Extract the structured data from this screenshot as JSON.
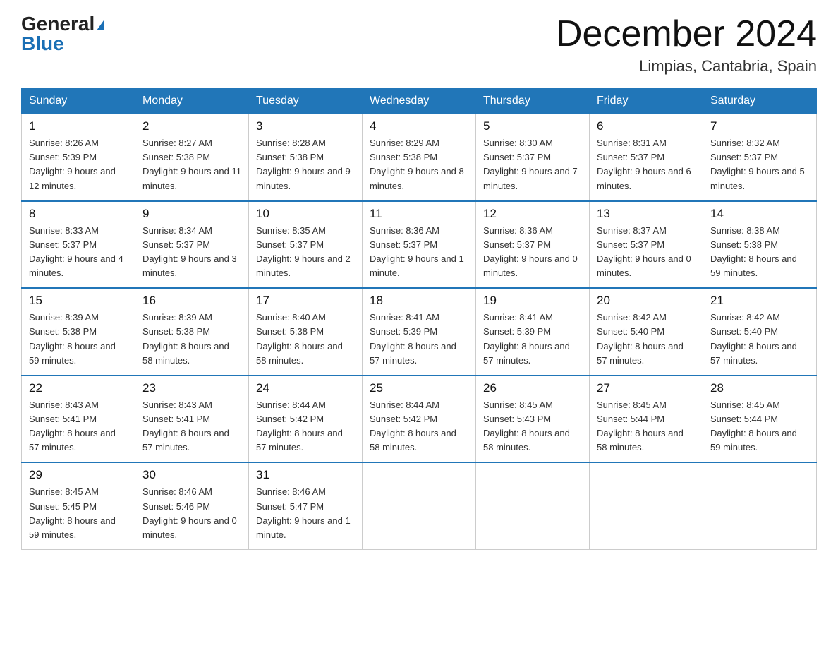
{
  "logo": {
    "part1": "General",
    "part2": "Blue"
  },
  "title": "December 2024",
  "location": "Limpias, Cantabria, Spain",
  "days_of_week": [
    "Sunday",
    "Monday",
    "Tuesday",
    "Wednesday",
    "Thursday",
    "Friday",
    "Saturday"
  ],
  "weeks": [
    [
      {
        "day": "1",
        "sunrise": "8:26 AM",
        "sunset": "5:39 PM",
        "daylight": "9 hours and 12 minutes."
      },
      {
        "day": "2",
        "sunrise": "8:27 AM",
        "sunset": "5:38 PM",
        "daylight": "9 hours and 11 minutes."
      },
      {
        "day": "3",
        "sunrise": "8:28 AM",
        "sunset": "5:38 PM",
        "daylight": "9 hours and 9 minutes."
      },
      {
        "day": "4",
        "sunrise": "8:29 AM",
        "sunset": "5:38 PM",
        "daylight": "9 hours and 8 minutes."
      },
      {
        "day": "5",
        "sunrise": "8:30 AM",
        "sunset": "5:37 PM",
        "daylight": "9 hours and 7 minutes."
      },
      {
        "day": "6",
        "sunrise": "8:31 AM",
        "sunset": "5:37 PM",
        "daylight": "9 hours and 6 minutes."
      },
      {
        "day": "7",
        "sunrise": "8:32 AM",
        "sunset": "5:37 PM",
        "daylight": "9 hours and 5 minutes."
      }
    ],
    [
      {
        "day": "8",
        "sunrise": "8:33 AM",
        "sunset": "5:37 PM",
        "daylight": "9 hours and 4 minutes."
      },
      {
        "day": "9",
        "sunrise": "8:34 AM",
        "sunset": "5:37 PM",
        "daylight": "9 hours and 3 minutes."
      },
      {
        "day": "10",
        "sunrise": "8:35 AM",
        "sunset": "5:37 PM",
        "daylight": "9 hours and 2 minutes."
      },
      {
        "day": "11",
        "sunrise": "8:36 AM",
        "sunset": "5:37 PM",
        "daylight": "9 hours and 1 minute."
      },
      {
        "day": "12",
        "sunrise": "8:36 AM",
        "sunset": "5:37 PM",
        "daylight": "9 hours and 0 minutes."
      },
      {
        "day": "13",
        "sunrise": "8:37 AM",
        "sunset": "5:37 PM",
        "daylight": "9 hours and 0 minutes."
      },
      {
        "day": "14",
        "sunrise": "8:38 AM",
        "sunset": "5:38 PM",
        "daylight": "8 hours and 59 minutes."
      }
    ],
    [
      {
        "day": "15",
        "sunrise": "8:39 AM",
        "sunset": "5:38 PM",
        "daylight": "8 hours and 59 minutes."
      },
      {
        "day": "16",
        "sunrise": "8:39 AM",
        "sunset": "5:38 PM",
        "daylight": "8 hours and 58 minutes."
      },
      {
        "day": "17",
        "sunrise": "8:40 AM",
        "sunset": "5:38 PM",
        "daylight": "8 hours and 58 minutes."
      },
      {
        "day": "18",
        "sunrise": "8:41 AM",
        "sunset": "5:39 PM",
        "daylight": "8 hours and 57 minutes."
      },
      {
        "day": "19",
        "sunrise": "8:41 AM",
        "sunset": "5:39 PM",
        "daylight": "8 hours and 57 minutes."
      },
      {
        "day": "20",
        "sunrise": "8:42 AM",
        "sunset": "5:40 PM",
        "daylight": "8 hours and 57 minutes."
      },
      {
        "day": "21",
        "sunrise": "8:42 AM",
        "sunset": "5:40 PM",
        "daylight": "8 hours and 57 minutes."
      }
    ],
    [
      {
        "day": "22",
        "sunrise": "8:43 AM",
        "sunset": "5:41 PM",
        "daylight": "8 hours and 57 minutes."
      },
      {
        "day": "23",
        "sunrise": "8:43 AM",
        "sunset": "5:41 PM",
        "daylight": "8 hours and 57 minutes."
      },
      {
        "day": "24",
        "sunrise": "8:44 AM",
        "sunset": "5:42 PM",
        "daylight": "8 hours and 57 minutes."
      },
      {
        "day": "25",
        "sunrise": "8:44 AM",
        "sunset": "5:42 PM",
        "daylight": "8 hours and 58 minutes."
      },
      {
        "day": "26",
        "sunrise": "8:45 AM",
        "sunset": "5:43 PM",
        "daylight": "8 hours and 58 minutes."
      },
      {
        "day": "27",
        "sunrise": "8:45 AM",
        "sunset": "5:44 PM",
        "daylight": "8 hours and 58 minutes."
      },
      {
        "day": "28",
        "sunrise": "8:45 AM",
        "sunset": "5:44 PM",
        "daylight": "8 hours and 59 minutes."
      }
    ],
    [
      {
        "day": "29",
        "sunrise": "8:45 AM",
        "sunset": "5:45 PM",
        "daylight": "8 hours and 59 minutes."
      },
      {
        "day": "30",
        "sunrise": "8:46 AM",
        "sunset": "5:46 PM",
        "daylight": "9 hours and 0 minutes."
      },
      {
        "day": "31",
        "sunrise": "8:46 AM",
        "sunset": "5:47 PM",
        "daylight": "9 hours and 1 minute."
      },
      null,
      null,
      null,
      null
    ]
  ]
}
